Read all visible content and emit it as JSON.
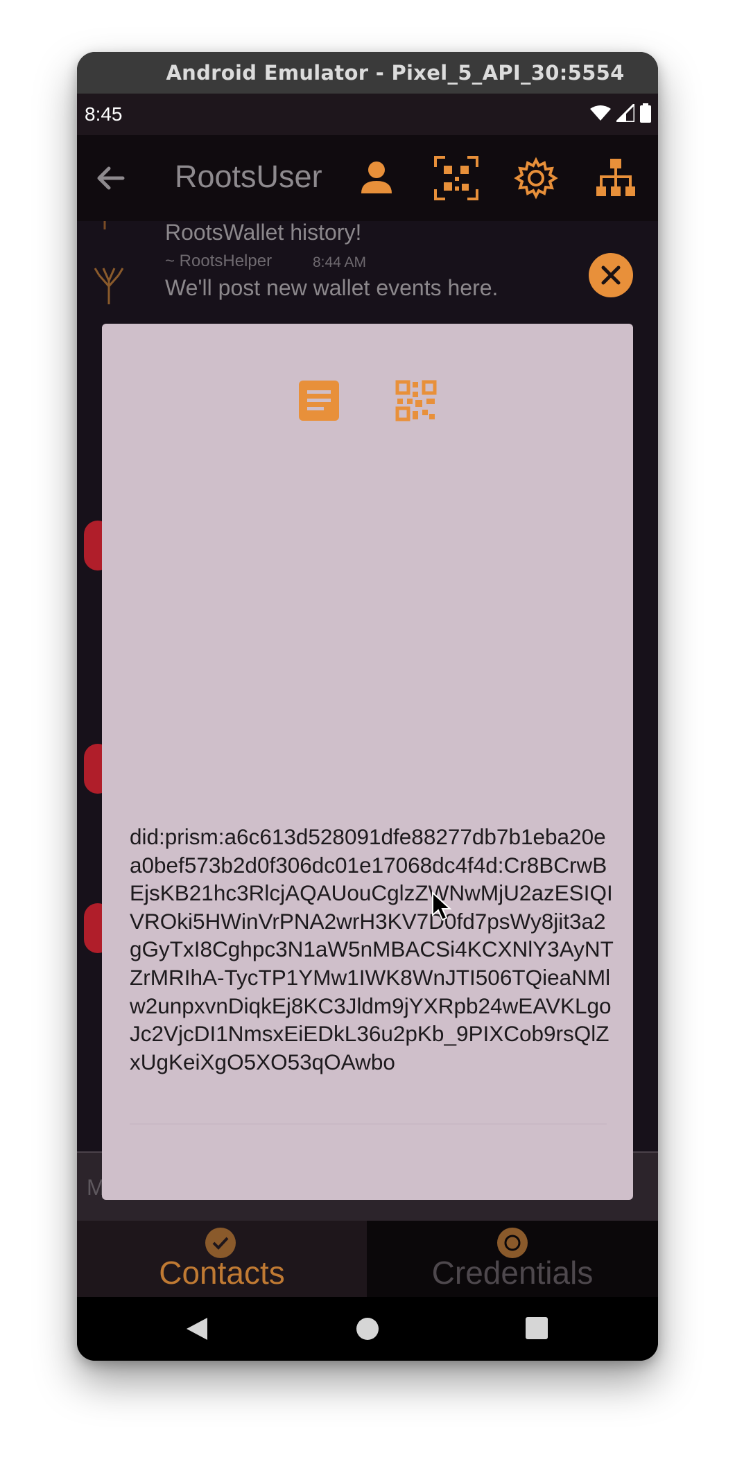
{
  "window": {
    "title": "Android Emulator - Pixel_5_API_30:5554"
  },
  "status_bar": {
    "time": "8:45"
  },
  "app_bar": {
    "title": "RootsUser",
    "icons": [
      "back-arrow-icon",
      "person-icon",
      "qr-scan-icon",
      "gear-icon",
      "hierarchy-icon"
    ]
  },
  "chat": {
    "messages": [
      {
        "text": "RootsWallet history!",
        "sender": "~ RootsHelper",
        "time": "8:44 AM"
      },
      {
        "text": "We'll post new wallet events here."
      }
    ],
    "input_placeholder": "M"
  },
  "dialog": {
    "tabs": [
      "document-icon",
      "qr-code-icon"
    ],
    "did": "did:prism:a6c613d528091dfe88277db7b1eba20ea0bef573b2d0f306dc01e17068dc4f4d:Cr8BCrwBEjsKB21hc3RlcjAQAUouCglzZWNwMjU2azESIQIVROki5HWinVrPNA2wrH3KV7D0fd7psWy8jit3a2gGyTxI8Cghpc3N1aW5nMBACSi4KCXNlY3AyNTZrMRIhA-TycTP1YMw1IWK8WnJTI506TQieaNMlw2unpxvnDiqkEj8KC3Jldm9jYXRpb24wEAVKLgoJc2VjcDI1NmsxEiEDkL36u2pKb_9PIXCob9rsQlZxUgKeiXgO5XO53qOAwbo"
  },
  "bottom_nav": {
    "contacts_label": "Contacts",
    "credentials_label": "Credentials"
  },
  "colors": {
    "accent": "#e8903a",
    "dialog_bg": "#cfbfca",
    "app_bg": "#100b0f",
    "alert": "#b01e2a"
  }
}
